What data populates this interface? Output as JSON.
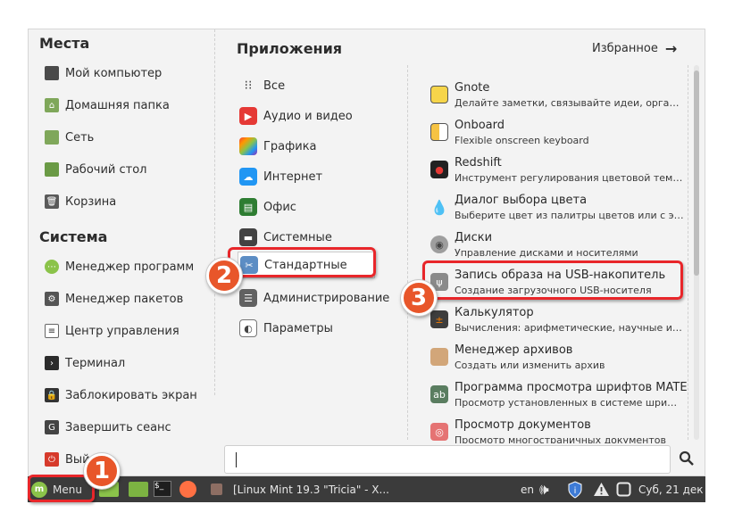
{
  "places": {
    "title": "Места",
    "items": [
      {
        "label": "Мой компьютер"
      },
      {
        "label": "Домашняя папка"
      },
      {
        "label": "Сеть"
      },
      {
        "label": "Рабочий стол"
      },
      {
        "label": "Корзина"
      }
    ]
  },
  "system": {
    "title": "Система",
    "items": [
      {
        "label": "Менеджер программ"
      },
      {
        "label": "Менеджер пакетов"
      },
      {
        "label": "Центр управления"
      },
      {
        "label": "Терминал"
      },
      {
        "label": "Заблокировать экран"
      },
      {
        "label": "Завершить сеанс"
      },
      {
        "label": "Вый"
      }
    ]
  },
  "apps_header": {
    "title": "Приложения",
    "favorites": "Избранное",
    "favorites_arrow": "→"
  },
  "categories": [
    {
      "label": "Все"
    },
    {
      "label": "Аудио и видео"
    },
    {
      "label": "Графика"
    },
    {
      "label": "Интернет"
    },
    {
      "label": "Офис"
    },
    {
      "label": "Системные"
    },
    {
      "label": "Стандартные"
    },
    {
      "label": "Администрирование"
    },
    {
      "label": "Параметры"
    }
  ],
  "apps": [
    {
      "name": "Gnote",
      "desc": "Делайте заметки, связывайте идеи, организуй..."
    },
    {
      "name": "Onboard",
      "desc": "Flexible onscreen keyboard"
    },
    {
      "name": "Redshift",
      "desc": "Инструмент регулирования цветовой темпера..."
    },
    {
      "name": "Диалог выбора цвета",
      "desc": "Выберите цвет из палитры цветов или с экрана"
    },
    {
      "name": "Диски",
      "desc": "Управление дисками и носителями"
    },
    {
      "name": "Запись образа на USB-накопитель",
      "desc": "Создание загрузочного USB-носителя"
    },
    {
      "name": "Калькулятор",
      "desc": "Вычисления: арифметические, научные и фин..."
    },
    {
      "name": "Менеджер архивов",
      "desc": "Создать или изменить архив"
    },
    {
      "name": "Программа просмотра шрифтов MATE",
      "desc": "Просмотр установленных в системе шрифтов"
    },
    {
      "name": "Просмотр документов",
      "desc": "Просмотр многостраничных документов"
    }
  ],
  "search": {
    "placeholder": ""
  },
  "taskbar": {
    "menu_label": "Menu",
    "window_title": "[Linux Mint 19.3 \"Tricia\" - X...",
    "lang": "en",
    "clock": "Суб, 21 дек"
  },
  "badges": [
    "1",
    "2",
    "3"
  ],
  "colors": {
    "highlight": "#e8262a",
    "badge": "#e8562a",
    "panel": "#3b3b3b",
    "mint_green": "#8bc34a"
  }
}
